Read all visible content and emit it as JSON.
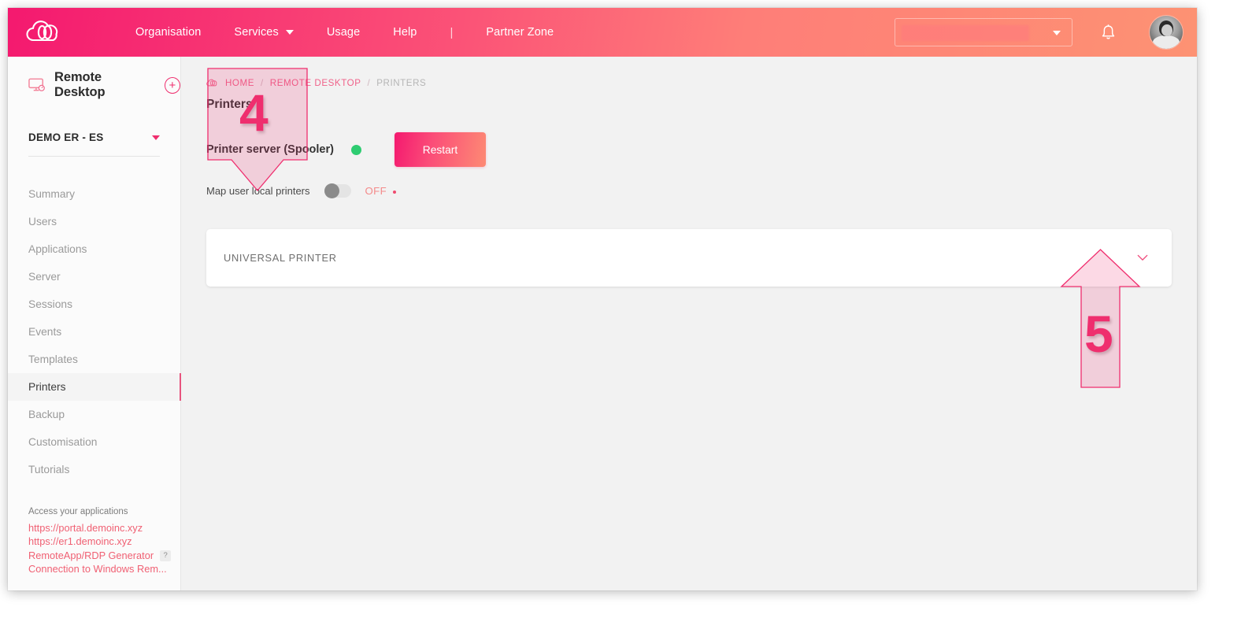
{
  "topbar": {
    "logo_name": "cloud-logo",
    "nav": [
      {
        "label": "Organisation",
        "has_caret": false
      },
      {
        "label": "Services",
        "has_caret": true
      },
      {
        "label": "Usage",
        "has_caret": false
      },
      {
        "label": "Help",
        "has_caret": false
      }
    ],
    "separator": "|",
    "partner_zone": "Partner Zone",
    "org_select_value": "",
    "notification_icon": "bell-icon",
    "avatar_label": "user-avatar"
  },
  "sidebar": {
    "service_title": "Remote Desktop",
    "service_icon": "monitor-icon",
    "add_button_label": "+",
    "org_name": "DEMO ER - ES",
    "items": [
      {
        "label": "Summary",
        "active": false
      },
      {
        "label": "Users",
        "active": false
      },
      {
        "label": "Applications",
        "active": false
      },
      {
        "label": "Server",
        "active": false
      },
      {
        "label": "Sessions",
        "active": false
      },
      {
        "label": "Events",
        "active": false
      },
      {
        "label": "Templates",
        "active": false
      },
      {
        "label": "Printers",
        "active": true
      },
      {
        "label": "Backup",
        "active": false
      },
      {
        "label": "Customisation",
        "active": false
      },
      {
        "label": "Tutorials",
        "active": false
      }
    ],
    "footer": {
      "title": "Access your applications",
      "links": [
        {
          "label": "https://portal.demoinc.xyz",
          "badge": null
        },
        {
          "label": "https://er1.demoinc.xyz",
          "badge": null
        },
        {
          "label": "RemoteApp/RDP Generator",
          "badge": "?"
        },
        {
          "label": "Connection to Windows Rem...",
          "badge": null
        }
      ]
    }
  },
  "main": {
    "breadcrumb": {
      "home_icon": "cloud-icon",
      "items": [
        {
          "label": "HOME",
          "current": false
        },
        {
          "label": "REMOTE DESKTOP",
          "current": false
        },
        {
          "label": "PRINTERS",
          "current": true
        }
      ],
      "separator": "/"
    },
    "page_title": "Printers",
    "server": {
      "label": "Printer server (Spooler)",
      "status_color": "#2ecc71",
      "restart_label": "Restart"
    },
    "map_printers": {
      "label": "Map user local printers",
      "state": "OFF",
      "enabled": false
    },
    "printer_card": {
      "title": "UNIVERSAL PRINTER",
      "expand_icon": "chevron-down-icon"
    }
  },
  "annotations": [
    {
      "number": "4",
      "direction": "down"
    },
    {
      "number": "5",
      "direction": "up"
    }
  ],
  "colors": {
    "brand_pink": "#f4196f",
    "brand_salmon": "#fd9273",
    "accent_link": "#f06073",
    "status_green": "#2ecc71",
    "annotation": "#ef2e6e"
  }
}
